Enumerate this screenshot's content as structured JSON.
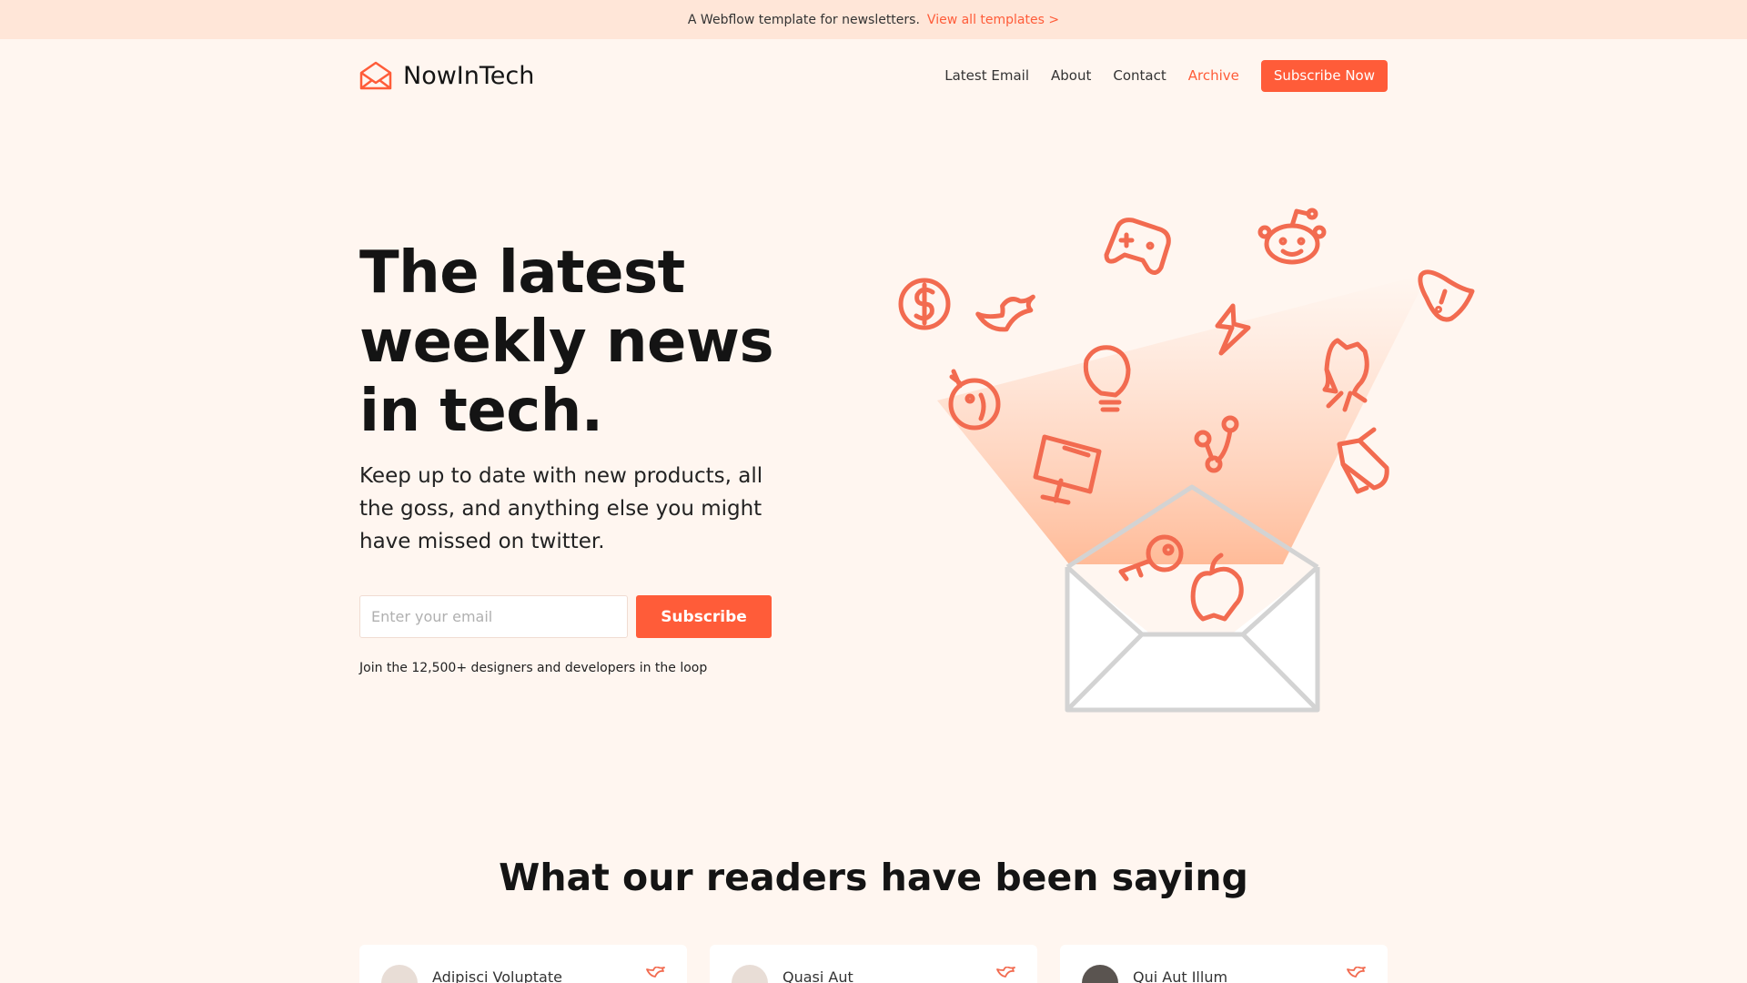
{
  "announcement": {
    "text": "A Webflow template for newsletters.",
    "link": "View all templates >"
  },
  "brand": {
    "name": "NowInTech",
    "icon": "envelope-icon"
  },
  "nav": {
    "links": [
      {
        "label": "Latest Email"
      },
      {
        "label": "About"
      },
      {
        "label": "Contact"
      },
      {
        "label": "Archive",
        "active": true
      }
    ],
    "cta": "Subscribe Now"
  },
  "hero": {
    "title_lines": [
      "The latest",
      "weekly news",
      "in tech."
    ],
    "subtitle": "Keep up to date with new products, all the goss, and anything else you might have missed on twitter.",
    "email_placeholder": "Enter your email",
    "button": "Subscribe",
    "note": "Join the 12,500+ designers and developers in the loop"
  },
  "illustration": {
    "icons": [
      "dollar-icon",
      "twitter-icon",
      "gamepad-icon",
      "reddit-icon",
      "alert-shield-icon",
      "lightning-icon",
      "bug-icon",
      "lightbulb-icon",
      "octocat-icon",
      "monitor-icon",
      "git-branch-icon",
      "megaphone-icon",
      "key-icon",
      "apple-icon",
      "envelope-icon"
    ]
  },
  "testimonials": {
    "title": "What our readers have been saying",
    "cards": [
      {
        "name": "Adipisci Voluptate"
      },
      {
        "name": "Quasi Aut"
      },
      {
        "name": "Qui Aut Illum"
      }
    ]
  },
  "colors": {
    "accent": "#ff5c39",
    "background": "#fff6f0",
    "banner": "#ffe6d8"
  }
}
